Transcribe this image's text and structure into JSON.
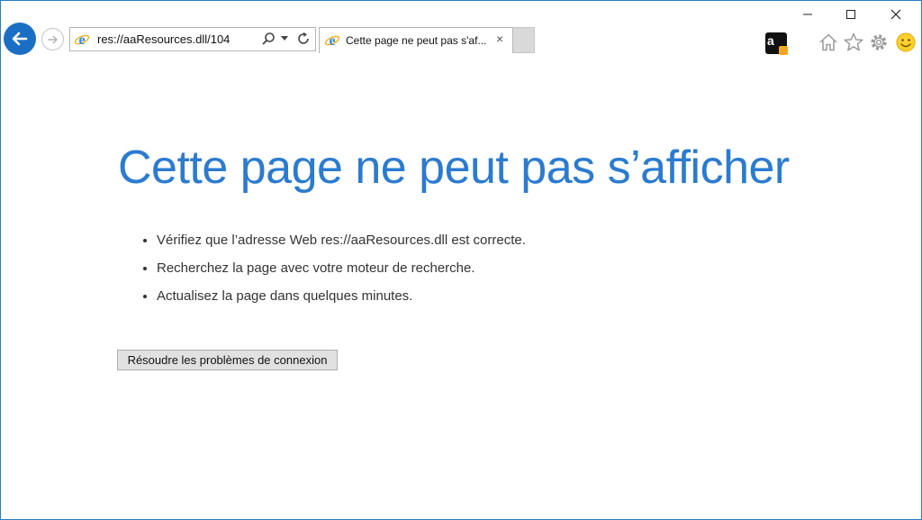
{
  "address_bar": {
    "url": "res://aaResources.dll/104"
  },
  "tabs": [
    {
      "title": "Cette page ne peut pas s'af...",
      "close": "×"
    }
  ],
  "icons": {
    "back": "back-arrow-icon",
    "forward": "forward-arrow-icon",
    "search": "search-icon",
    "refresh": "refresh-icon",
    "amazon": "amazon-icon",
    "home": "home-icon",
    "favorites": "star-icon",
    "settings": "gear-icon",
    "feedback": "smiley-icon"
  },
  "amazon_letter": "a",
  "window": {
    "minimize": "—",
    "maximize": "☐",
    "close": "✕"
  },
  "error": {
    "title": "Cette page ne peut pas s’afficher",
    "tips": [
      "Vérifiez que l’adresse Web res://aaResources.dll est correcte.",
      "Recherchez la page avec votre moteur de recherche.",
      "Actualisez la page dans quelques minutes."
    ],
    "fix_button": "Résoudre les problèmes de connexion"
  },
  "colors": {
    "accent": "#2b7bd0",
    "back_button": "#1a6fc4",
    "frame": "#2b7cc7"
  }
}
